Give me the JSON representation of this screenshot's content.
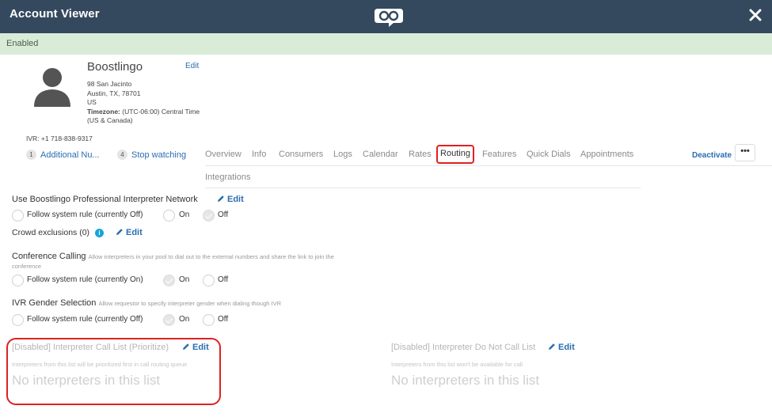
{
  "header": {
    "title": "Account Viewer",
    "logo_icon": "boostlingo-logo-icon",
    "close_icon": "close-icon",
    "bg_color": "#34495e"
  },
  "status_banner": {
    "text": "Enabled",
    "bg_color": "#d9ecd7"
  },
  "account": {
    "name": "Boostlingo",
    "edit_label": "Edit",
    "address_line1": "98 San Jacinto",
    "address_line2": "Austin, TX, 78701",
    "address_line3": "US",
    "timezone_label": "Timezone:",
    "timezone_value": "(UTC-06:00) Central Time",
    "timezone_value2": "(US & Canada)",
    "ivr": "IVR: +1 718-838-9317",
    "avatar_icon": "user-avatar-icon"
  },
  "nav": {
    "additional_count": "1",
    "additional_label": "Additional Nu...",
    "stop_count": "4",
    "stop_label": "Stop watching",
    "tabs": [
      "Overview",
      "Info",
      "Consumers",
      "Logs",
      "Calendar",
      "Rates",
      "Routing",
      "Features",
      "Quick Dials",
      "Appointments",
      "Integrations"
    ],
    "active_tab": "Routing",
    "deactivate_label": "Deactivate",
    "more_label": "•••"
  },
  "settings": {
    "network_title": "Use Boostlingo Professional Interpreter Network",
    "network_edit": "Edit",
    "network_options": [
      "Follow system rule (currently Off)",
      "On",
      "Off"
    ],
    "network_selected": "Off",
    "crowd_label": "Crowd exclusions (0)",
    "crowd_edit": "Edit",
    "conference_title": "Conference Calling",
    "conference_desc1": "Allow interpreters in your pool to dial out to the external numbers and share the link to join the",
    "conference_desc2": "conference",
    "conference_options": [
      "Follow system rule (currently On)",
      "On",
      "Off"
    ],
    "conference_selected": "On",
    "ivr_gender_title": "IVR Gender Selection",
    "ivr_gender_desc": "Allow requestor to specify interpreter gender when dialing though IVR",
    "ivr_gender_options": [
      "Follow system rule (currently Off)",
      "On",
      "Off"
    ],
    "ivr_gender_selected": "On"
  },
  "lists": {
    "call_list_title": "[Disabled] Interpreter Call List (Prioritize)",
    "call_list_edit": "Edit",
    "call_list_desc": "Interpreters from this list will be prioritized first in call routing queue",
    "call_list_empty": "No interpreters in this list",
    "dnc_title": "[Disabled] Interpreter Do Not Call List",
    "dnc_edit": "Edit",
    "dnc_desc": "Interpreters from this list won't be available for call",
    "dnc_empty": "No interpreters in this list"
  },
  "colors": {
    "link": "#2a6db0",
    "highlight": "#e02020",
    "info": "#1aa3d9"
  }
}
